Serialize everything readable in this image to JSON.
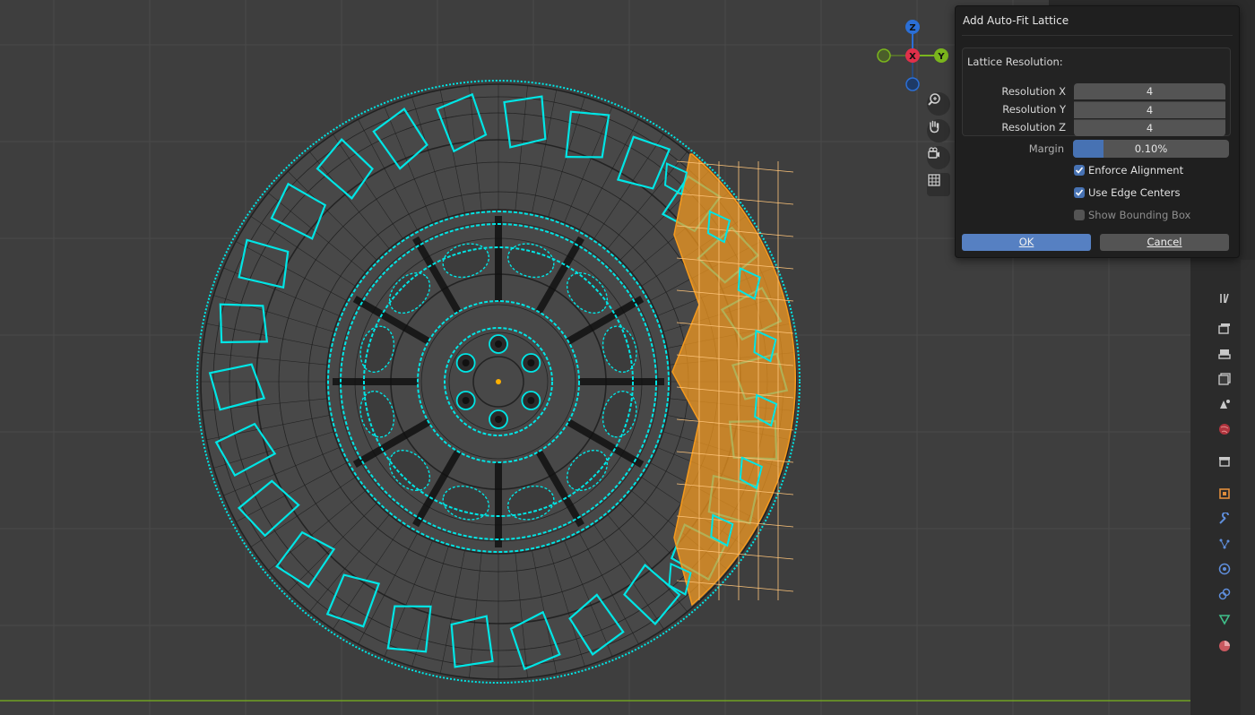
{
  "dialog": {
    "title": "Add Auto-Fit Lattice",
    "lattice_resolution_label": "Lattice Resolution:",
    "resolution_x_label": "Resolution X",
    "resolution_x_value": "4",
    "resolution_y_label": "Resolution Y",
    "resolution_y_value": "4",
    "resolution_z_label": "Resolution Z",
    "resolution_z_value": "4",
    "margin_label": "Margin",
    "margin_value": "0.10%",
    "enforce_alignment_label": "Enforce Alignment",
    "enforce_alignment_checked": true,
    "use_edge_centers_label": "Use Edge Centers",
    "use_edge_centers_checked": true,
    "show_bounding_box_label": "Show Bounding Box",
    "show_bounding_box_checked": false,
    "ok_label": "OK",
    "cancel_label": "Cancel"
  },
  "gizmo": {
    "x_label": "X",
    "y_label": "Y",
    "z_label": "Z"
  },
  "colors": {
    "mesh_selected": "#00e5e5",
    "lattice": "#f59a1e",
    "x_axis": "#e0304a",
    "y_axis": "#7ab51d",
    "z_axis": "#2b6fd6",
    "accent": "#4772b3"
  },
  "viewport_icons": [
    "zoom-icon",
    "pan-hand-icon",
    "camera-icon",
    "grid-icon"
  ],
  "property_tabs": [
    "tool-icon",
    "render-icon",
    "output-icon",
    "view-layer-icon",
    "scene-icon",
    "world-icon",
    "collection-icon",
    "object-icon",
    "modifier-icon",
    "particles-icon",
    "physics-icon",
    "constraints-icon",
    "data-icon",
    "material-icon"
  ]
}
